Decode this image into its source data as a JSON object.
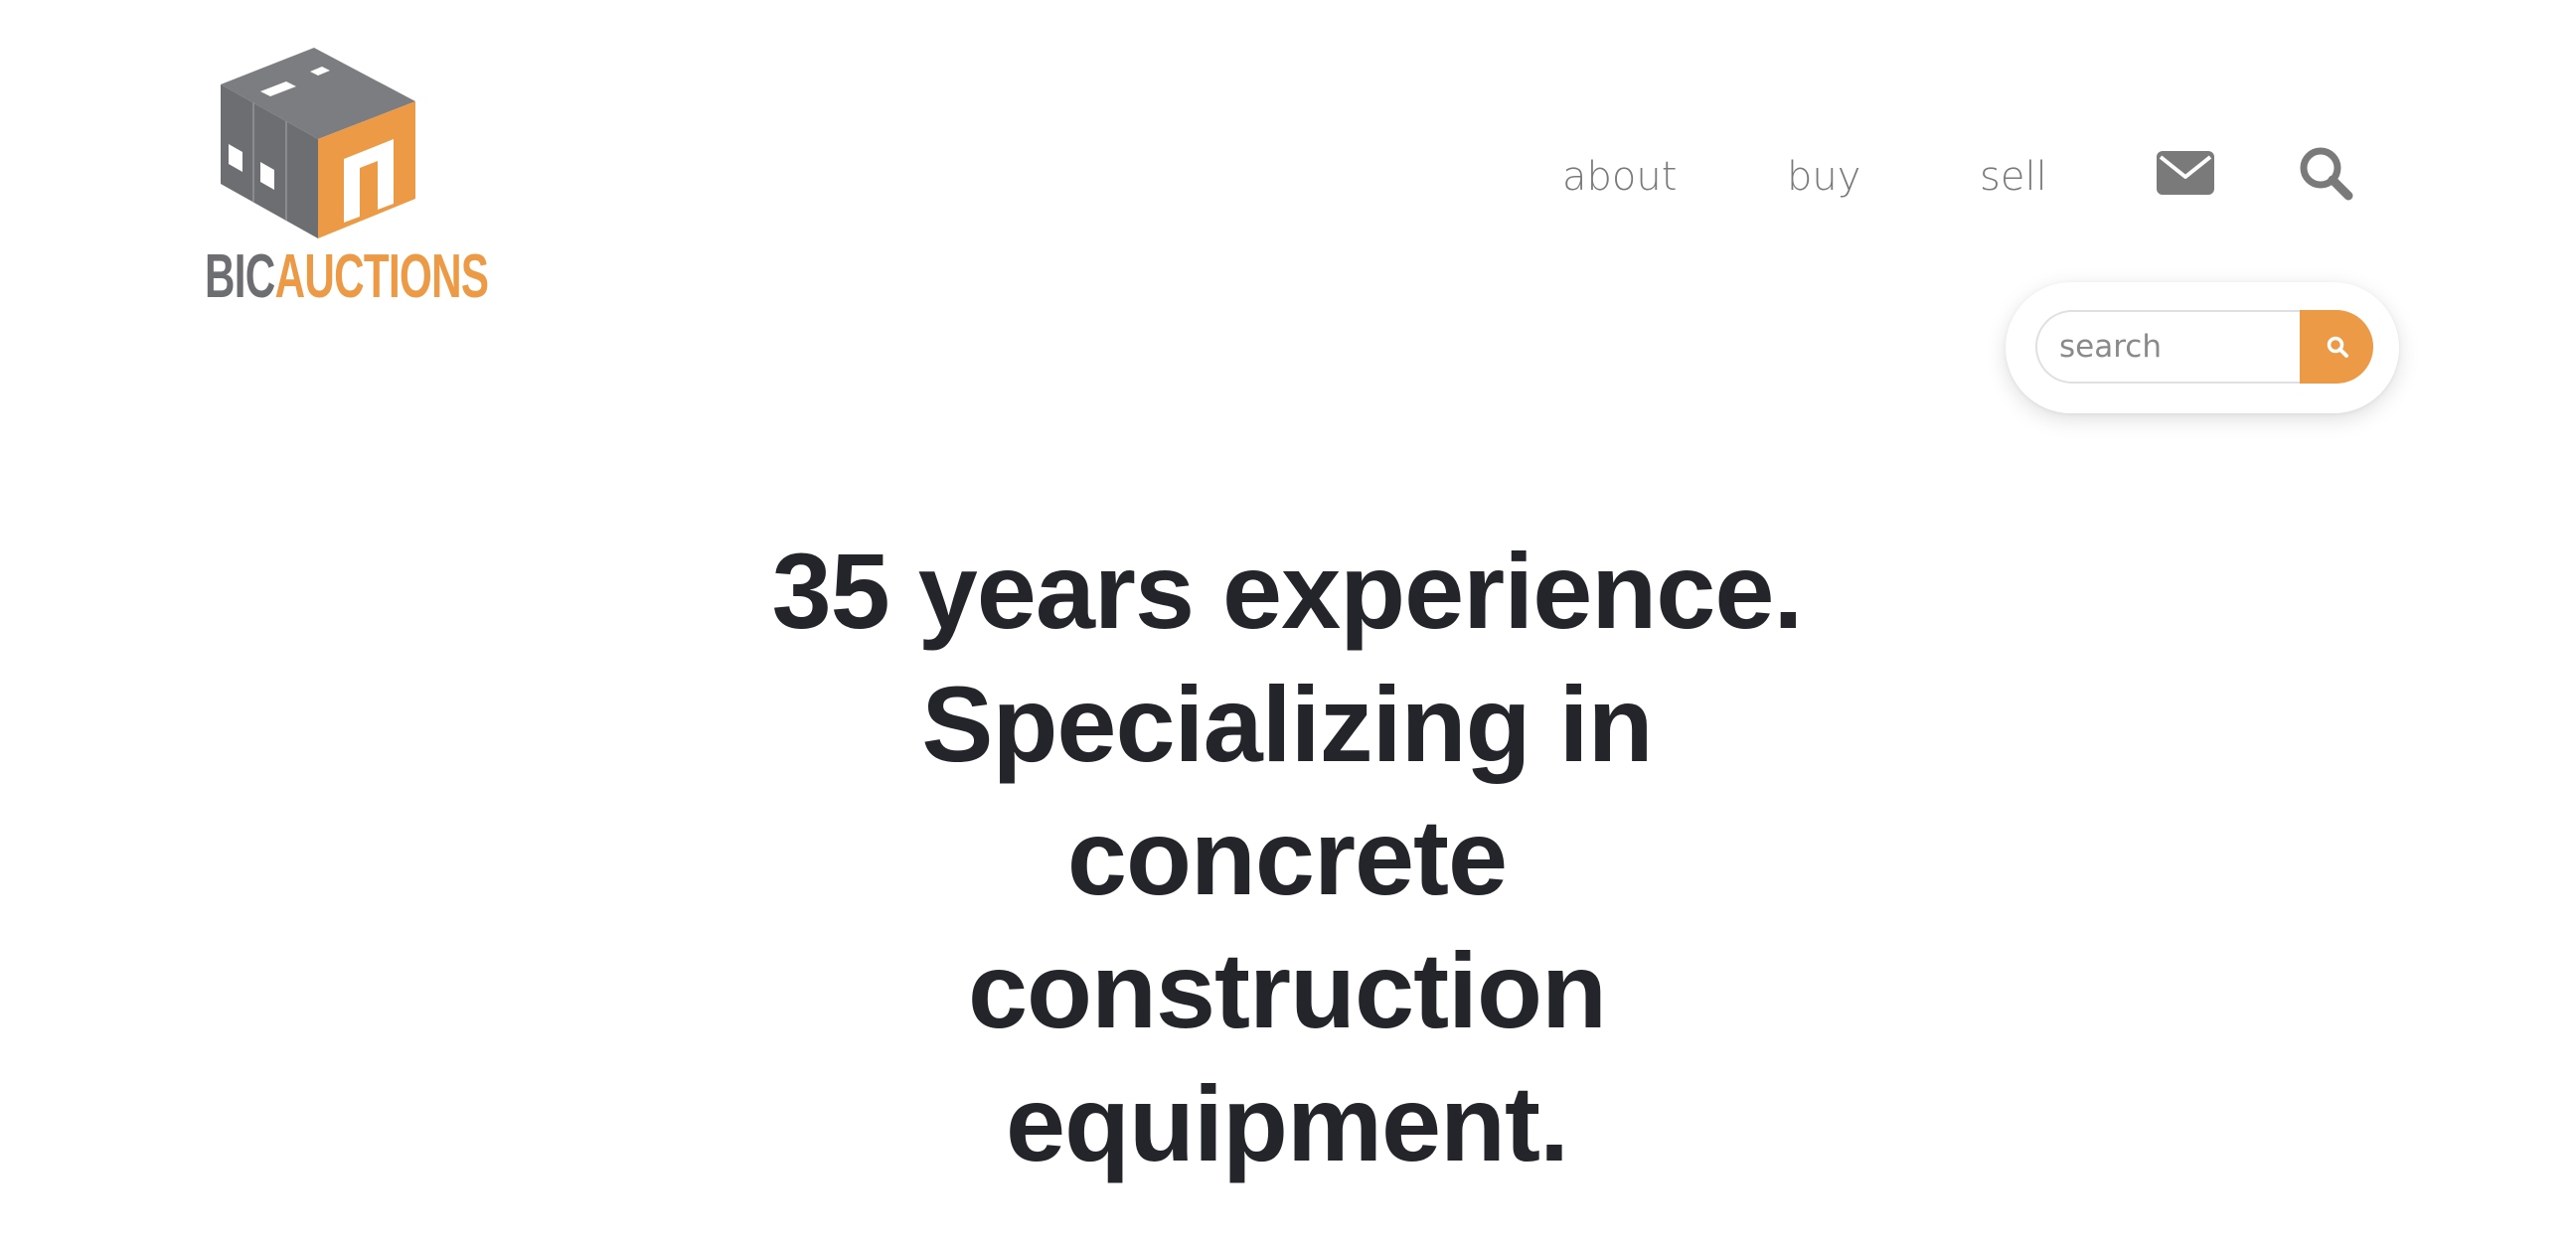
{
  "brand": {
    "name_part1": "BIC",
    "name_part2": "AUCTIONS",
    "logo_icon": "warehouse-building-logo",
    "colors": {
      "gray": "#6d6e71",
      "orange": "#ec9a45"
    }
  },
  "nav": {
    "items": [
      {
        "label": "about"
      },
      {
        "label": "buy"
      },
      {
        "label": "sell"
      }
    ],
    "mail_icon": "envelope-icon",
    "search_icon": "magnifier-icon"
  },
  "search": {
    "placeholder": "search",
    "value": "",
    "button_icon": "magnifier-icon",
    "accent": "#ec9a45"
  },
  "hero": {
    "lines": [
      "35 years experience.",
      "Specializing in",
      "concrete",
      "construction",
      "equipment."
    ],
    "color": "#23252b"
  }
}
